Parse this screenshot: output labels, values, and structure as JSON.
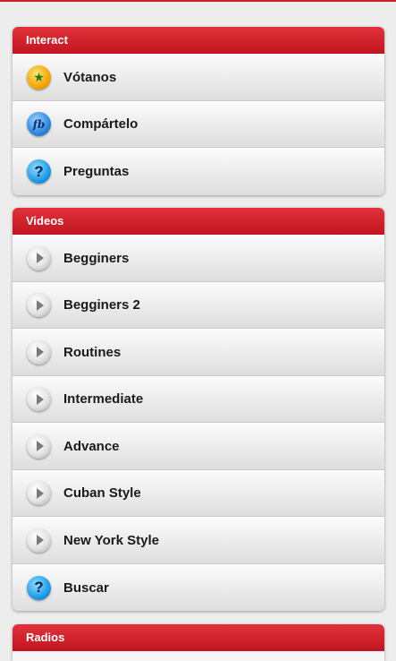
{
  "sections": [
    {
      "title": "Interact",
      "items": [
        {
          "label": "Vótanos",
          "icon": "star-icon"
        },
        {
          "label": "Compártelo",
          "icon": "facebook-icon"
        },
        {
          "label": "Preguntas",
          "icon": "help-icon"
        }
      ]
    },
    {
      "title": "Videos",
      "items": [
        {
          "label": "Begginers",
          "icon": "play-icon"
        },
        {
          "label": "Begginers 2",
          "icon": "play-icon"
        },
        {
          "label": "Routines",
          "icon": "play-icon"
        },
        {
          "label": "Intermediate",
          "icon": "play-icon"
        },
        {
          "label": "Advance",
          "icon": "play-icon"
        },
        {
          "label": "Cuban Style",
          "icon": "play-icon"
        },
        {
          "label": "New York Style",
          "icon": "play-icon"
        },
        {
          "label": "Buscar",
          "icon": "help-icon"
        }
      ]
    },
    {
      "title": "Radios",
      "items": []
    }
  ],
  "colors": {
    "header_red": "#c9242c",
    "background": "#ededed"
  }
}
